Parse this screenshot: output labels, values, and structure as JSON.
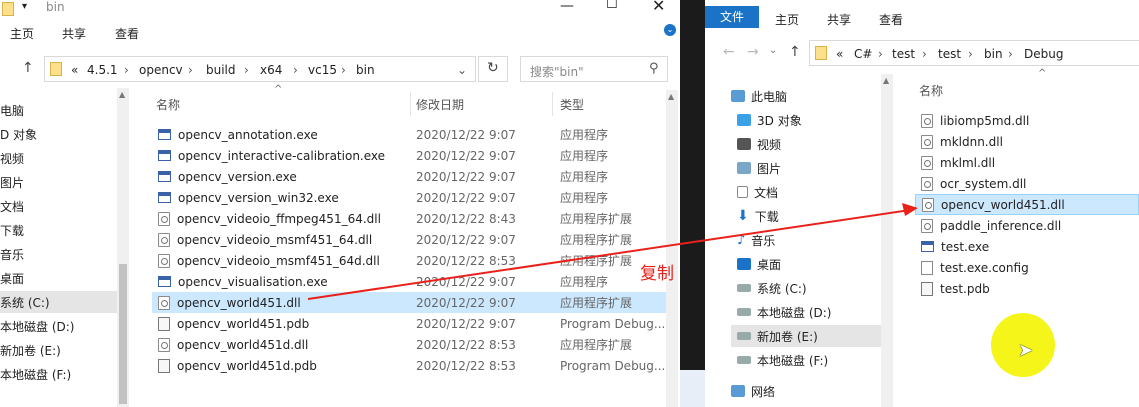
{
  "left": {
    "title": "bin",
    "ribbon_tabs": [
      "主页",
      "共享",
      "查看"
    ],
    "breadcrumb": [
      "«",
      "4.5.1",
      "opencv",
      "build",
      "x64",
      "vc15",
      "bin"
    ],
    "search_placeholder": "搜索\"bin\"",
    "nav_items": [
      "电脑",
      "D 对象",
      "视频",
      "图片",
      "文档",
      "下载",
      "音乐",
      "桌面",
      "系统 (C:)",
      "本地磁盘 (D:)",
      "新加卷 (E:)",
      "本地磁盘 (F:)"
    ],
    "columns": {
      "name": "名称",
      "date": "修改日期",
      "type": "类型"
    },
    "files": [
      {
        "name": "opencv_annotation.exe",
        "date": "2020/12/22 9:07",
        "type": "应用程序",
        "icon": "exe"
      },
      {
        "name": "opencv_interactive-calibration.exe",
        "date": "2020/12/22 9:07",
        "type": "应用程序",
        "icon": "exe"
      },
      {
        "name": "opencv_version.exe",
        "date": "2020/12/22 9:07",
        "type": "应用程序",
        "icon": "exe"
      },
      {
        "name": "opencv_version_win32.exe",
        "date": "2020/12/22 9:07",
        "type": "应用程序",
        "icon": "exe"
      },
      {
        "name": "opencv_videoio_ffmpeg451_64.dll",
        "date": "2020/12/22 8:43",
        "type": "应用程序扩展",
        "icon": "dll"
      },
      {
        "name": "opencv_videoio_msmf451_64.dll",
        "date": "2020/12/22 9:07",
        "type": "应用程序扩展",
        "icon": "dll"
      },
      {
        "name": "opencv_videoio_msmf451_64d.dll",
        "date": "2020/12/22 8:53",
        "type": "应用程序扩展",
        "icon": "dll"
      },
      {
        "name": "opencv_visualisation.exe",
        "date": "2020/12/22 9:07",
        "type": "应用程序",
        "icon": "exe"
      },
      {
        "name": "opencv_world451.dll",
        "date": "2020/12/22 9:07",
        "type": "应用程序扩展",
        "icon": "dll"
      },
      {
        "name": "opencv_world451.pdb",
        "date": "2020/12/22 9:07",
        "type": "Program Debug...",
        "icon": "pdb"
      },
      {
        "name": "opencv_world451d.dll",
        "date": "2020/12/22 8:53",
        "type": "应用程序扩展",
        "icon": "dll"
      },
      {
        "name": "opencv_world451d.pdb",
        "date": "2020/12/22 8:53",
        "type": "Program Debug...",
        "icon": "pdb"
      }
    ]
  },
  "right": {
    "ribbon_tabs": [
      "文件",
      "主页",
      "共享",
      "查看"
    ],
    "breadcrumb": [
      "«",
      "C#",
      "test",
      "test",
      "bin",
      "Debug"
    ],
    "nav_items": [
      "此电脑",
      "3D 对象",
      "视频",
      "图片",
      "文档",
      "下载",
      "音乐",
      "桌面",
      "系统 (C:)",
      "本地磁盘 (D:)",
      "新加卷 (E:)",
      "本地磁盘 (F:)",
      "网络"
    ],
    "column_name": "名称",
    "files": [
      {
        "name": "libiomp5md.dll",
        "icon": "dll"
      },
      {
        "name": "mkldnn.dll",
        "icon": "dll"
      },
      {
        "name": "mklml.dll",
        "icon": "dll"
      },
      {
        "name": "ocr_system.dll",
        "icon": "dll"
      },
      {
        "name": "opencv_world451.dll",
        "icon": "dll"
      },
      {
        "name": "paddle_inference.dll",
        "icon": "dll"
      },
      {
        "name": "test.exe",
        "icon": "exe"
      },
      {
        "name": "test.exe.config",
        "icon": "cfg"
      },
      {
        "name": "test.pdb",
        "icon": "pdb"
      }
    ]
  },
  "annotation": {
    "label": "复制",
    "color": "#e8221b"
  },
  "colors": {
    "selection": "#cce8ff",
    "file_tab": "#1a73c7",
    "cursor_highlight": "#f5f51a"
  }
}
